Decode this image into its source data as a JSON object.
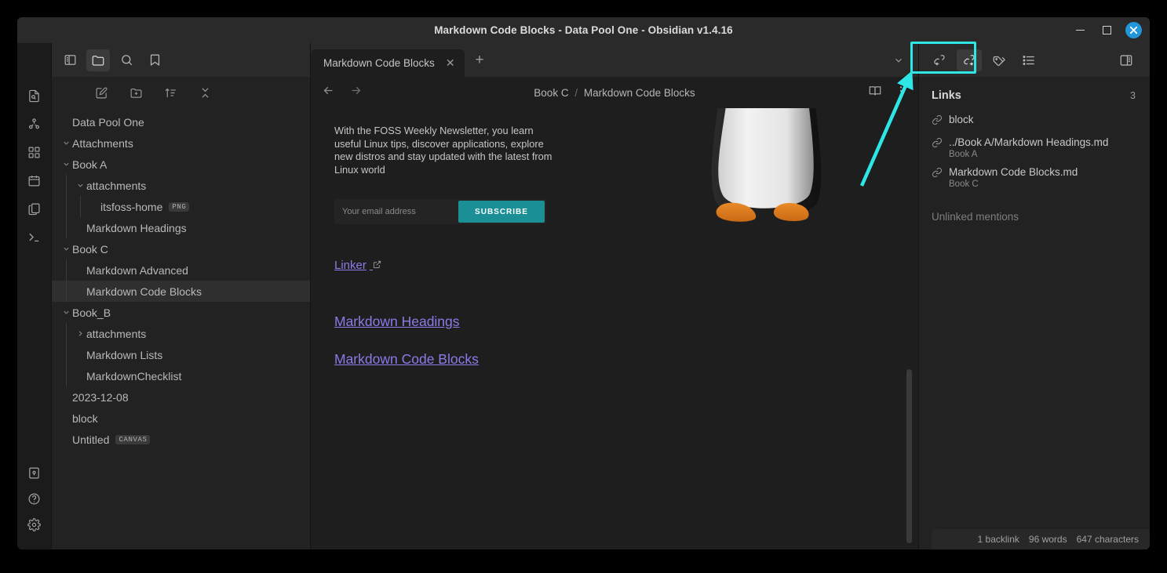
{
  "window": {
    "title": "Markdown Code Blocks - Data Pool One - Obsidian v1.4.16",
    "minimize_label": "Minimize",
    "maximize_label": "Maximize",
    "close_label": "×"
  },
  "ribbon": {
    "items": [
      {
        "icon": "file-search-icon",
        "label": "Quick switcher"
      },
      {
        "icon": "graph-view-icon",
        "label": "Open graph view"
      },
      {
        "icon": "canvas-grid-icon",
        "label": "Create new canvas"
      },
      {
        "icon": "calendar-icon",
        "label": "Open daily note"
      },
      {
        "icon": "templates-copy-icon",
        "label": "Insert template"
      },
      {
        "icon": "terminal-icon",
        "label": "Open terminal"
      }
    ],
    "bottom_items": [
      {
        "icon": "vault-switcher-icon",
        "label": "Open another vault"
      },
      {
        "icon": "help-icon",
        "label": "Help"
      },
      {
        "icon": "settings-gear-icon",
        "label": "Settings"
      }
    ]
  },
  "sidebar": {
    "toolbar": [
      {
        "icon": "toggle-left-sidebar-icon",
        "label": "Toggle left sidebar",
        "active": false
      },
      {
        "icon": "folder-icon",
        "label": "Files",
        "active": true
      },
      {
        "icon": "search-icon",
        "label": "Search",
        "active": false
      },
      {
        "icon": "bookmark-icon",
        "label": "Bookmarks",
        "active": false
      }
    ],
    "nav_actions": [
      {
        "icon": "new-note-icon",
        "label": "New note"
      },
      {
        "icon": "new-folder-icon",
        "label": "New folder"
      },
      {
        "icon": "sort-icon",
        "label": "Change sort order"
      },
      {
        "icon": "collapse-all-icon",
        "label": "Collapse all"
      }
    ],
    "tree": [
      {
        "label": "Data Pool One",
        "depth": 0,
        "chevron": "none",
        "type": "vault",
        "selected": false
      },
      {
        "label": "Attachments",
        "depth": 0,
        "chevron": "down",
        "type": "folder",
        "selected": false
      },
      {
        "label": "Book A",
        "depth": 0,
        "chevron": "down",
        "type": "folder",
        "selected": false
      },
      {
        "label": "attachments",
        "depth": 1,
        "chevron": "down",
        "type": "folder",
        "selected": false
      },
      {
        "label": "itsfoss-home",
        "depth": 2,
        "chevron": "none",
        "type": "file",
        "badge": "PNG",
        "selected": false
      },
      {
        "label": "Markdown Headings",
        "depth": 1,
        "chevron": "none",
        "type": "file",
        "selected": false
      },
      {
        "label": "Book C",
        "depth": 0,
        "chevron": "down",
        "type": "folder",
        "selected": false
      },
      {
        "label": "Markdown Advanced",
        "depth": 1,
        "chevron": "none",
        "type": "file",
        "selected": false
      },
      {
        "label": "Markdown Code Blocks",
        "depth": 1,
        "chevron": "none",
        "type": "file",
        "selected": true
      },
      {
        "label": "Book_B",
        "depth": 0,
        "chevron": "down",
        "type": "folder",
        "selected": false
      },
      {
        "label": "attachments",
        "depth": 1,
        "chevron": "right",
        "type": "folder",
        "selected": false
      },
      {
        "label": "Markdown Lists",
        "depth": 1,
        "chevron": "none",
        "type": "file",
        "selected": false
      },
      {
        "label": "MarkdownChecklist",
        "depth": 1,
        "chevron": "none",
        "type": "file",
        "selected": false
      },
      {
        "label": "2023-12-08",
        "depth": 0,
        "chevron": "none",
        "type": "file",
        "selected": false
      },
      {
        "label": "block",
        "depth": 0,
        "chevron": "none",
        "type": "file",
        "selected": false
      },
      {
        "label": "Untitled",
        "depth": 0,
        "chevron": "none",
        "type": "file",
        "badge": "CANVAS",
        "selected": false
      }
    ]
  },
  "tabs": {
    "items": [
      {
        "label": "Markdown Code Blocks",
        "active": true
      }
    ],
    "close_label": "✕",
    "new_tab_label": "+",
    "tab_list_label": "⌄"
  },
  "pane": {
    "back_label": "←",
    "forward_label": "→",
    "breadcrumb_parent": "Book C",
    "breadcrumb_sep": "/",
    "breadcrumb_current": "Markdown Code Blocks",
    "reading_view_label": "Reading view",
    "more_options_label": "⋮"
  },
  "note": {
    "newsletter_text": "With the FOSS Weekly Newsletter, you learn useful Linux tips, discover applications, explore new distros and stay updated with the latest from Linux world",
    "email_placeholder": "Your email address",
    "subscribe_label": "SUBSCRIBE",
    "links": [
      {
        "text": "Linker",
        "external": true
      },
      {
        "text": "Markdown Headings",
        "external": false
      },
      {
        "text": "Markdown Code Blocks",
        "external": false
      }
    ]
  },
  "rightbar": {
    "toolbar": [
      {
        "icon": "backlinks-icon",
        "label": "Backlinks",
        "active": false,
        "highlighted": true
      },
      {
        "icon": "outgoing-links-icon",
        "label": "Outgoing links",
        "active": true,
        "highlighted": true
      },
      {
        "icon": "tags-icon",
        "label": "Tags",
        "active": false,
        "highlighted": false
      },
      {
        "icon": "outline-icon",
        "label": "Outline",
        "active": false,
        "highlighted": false
      }
    ],
    "toggle_right_sidebar_label": "Toggle right sidebar",
    "panel_title": "Links",
    "panel_count": "3",
    "links": [
      {
        "title": "block",
        "subtitle": ""
      },
      {
        "title": "../Book A/Markdown Headings.md",
        "subtitle": "Book A"
      },
      {
        "title": "Markdown Code Blocks.md",
        "subtitle": "Book C"
      }
    ],
    "unlinked_label": "Unlinked mentions"
  },
  "statusbar": {
    "backlinks": "1 backlink",
    "words": "96 words",
    "characters": "647 characters"
  },
  "annotation": {
    "color": "#2ee6e6",
    "target": "outgoing-links-toolbar-buttons"
  }
}
